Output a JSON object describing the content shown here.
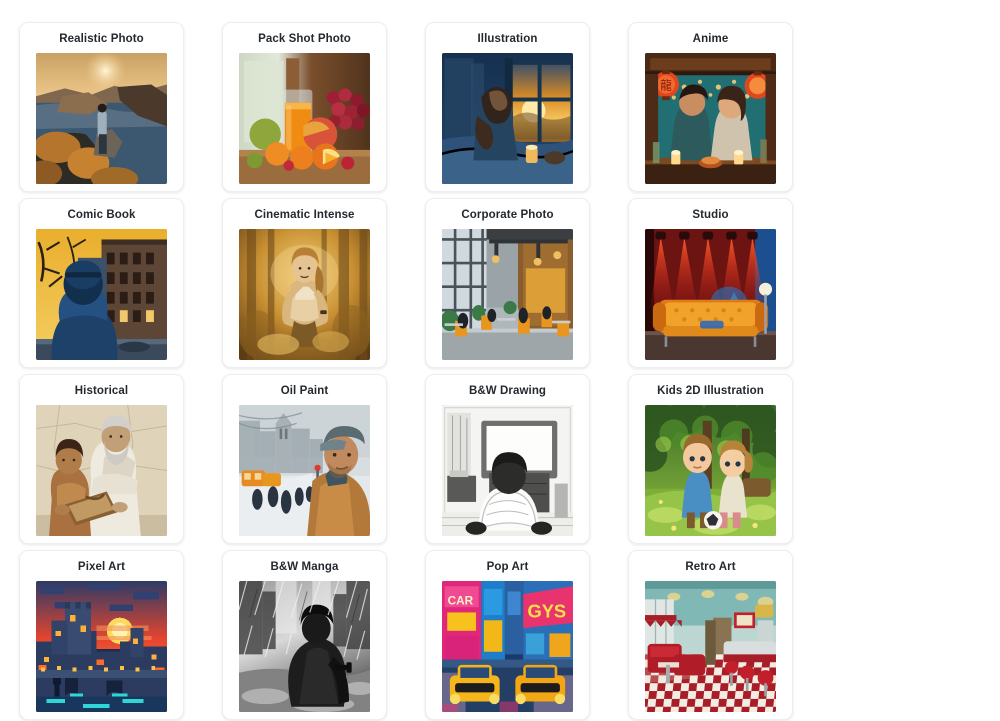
{
  "gallery": {
    "columns": 4,
    "rows": 4,
    "background_color": "#ffffff",
    "card_background_color": "#ffffff",
    "card_border_color": "#eceef0",
    "title_color": "#24292f",
    "cards": [
      {
        "label": "Realistic Photo",
        "thumbnail": "sunset-coastline-cliff-person-photo"
      },
      {
        "label": "Pack Shot Photo",
        "thumbnail": "orange-juice-glass-with-fruit-still-life"
      },
      {
        "label": "Illustration",
        "thumbnail": "woman-on-bed-at-window-sunrise-blue-illustration"
      },
      {
        "label": "Anime",
        "thumbnail": "couple-at-lantern-lit-noodle-bar-anime"
      },
      {
        "label": "Comic Book",
        "thumbnail": "hooded-figure-on-city-street-comic"
      },
      {
        "label": "Cinematic Intense",
        "thumbnail": "woman-running-in-golden-forest-cinematic"
      },
      {
        "label": "Corporate Photo",
        "thumbnail": "modern-open-office-cafe-interior"
      },
      {
        "label": "Studio",
        "thumbnail": "orange-sofa-red-stage-lights-studio"
      },
      {
        "label": "Historical",
        "thumbnail": "greek-philosopher-and-boy-fresco"
      },
      {
        "label": "Oil Paint",
        "thumbnail": "man-in-flat-cap-snowy-street-oil-painting"
      },
      {
        "label": "B&W Drawing",
        "thumbnail": "person-watching-tv-pencil-drawing"
      },
      {
        "label": "Kids 2D Illustration",
        "thumbnail": "two-children-with-ball-in-garden"
      },
      {
        "label": "Pixel Art",
        "thumbnail": "castle-ruins-sunset-bridge-pixel-art"
      },
      {
        "label": "B&W Manga",
        "thumbnail": "coated-figure-in-rain-manga"
      },
      {
        "label": "Pop Art",
        "thumbnail": "yellow-taxis-times-square-pop-art"
      },
      {
        "label": "Retro Art",
        "thumbnail": "american-diner-checker-floor-retro"
      }
    ]
  }
}
